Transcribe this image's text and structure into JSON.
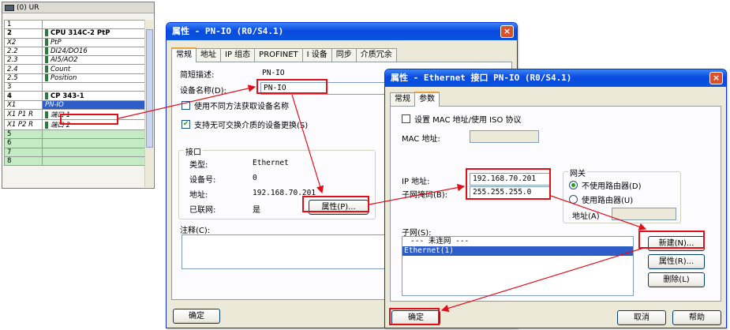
{
  "rack": {
    "title": "(0) UR",
    "rows": [
      {
        "slot": "1",
        "module": "",
        "style": "plain"
      },
      {
        "slot": "2",
        "module": "CPU 314C-2 PtP",
        "style": "bold",
        "icon": true
      },
      {
        "slot": "X2",
        "module": "PtP",
        "style": "italic",
        "icon": true
      },
      {
        "slot": "2.2",
        "module": "DI24/DO16",
        "style": "italic",
        "icon": true
      },
      {
        "slot": "2.3",
        "module": "AI5/AO2",
        "style": "italic",
        "icon": true
      },
      {
        "slot": "2.4",
        "module": "Count",
        "style": "italic",
        "icon": true
      },
      {
        "slot": "2.5",
        "module": "Position",
        "style": "italic",
        "icon": true
      },
      {
        "slot": "3",
        "module": "",
        "style": "plain"
      },
      {
        "slot": "4",
        "module": "CP 343-1",
        "style": "bold",
        "icon": true
      },
      {
        "slot": "X1",
        "module": "PN-IO",
        "style": "sel",
        "icon": false
      },
      {
        "slot": "X1 P1 R",
        "module": "端口 1",
        "style": "italic",
        "icon": true
      },
      {
        "slot": "X1 P2 R",
        "module": "端口 2",
        "style": "italic",
        "icon": true
      },
      {
        "slot": "5",
        "module": "",
        "style": "green"
      },
      {
        "slot": "6",
        "module": "",
        "style": "green"
      },
      {
        "slot": "7",
        "module": "",
        "style": "green"
      },
      {
        "slot": "8",
        "module": "",
        "style": "green"
      }
    ]
  },
  "dlg1": {
    "title": "属性 - PN-IO (R0/S4.1)",
    "close": "×",
    "tabs": [
      "常规",
      "地址",
      "IP 组态",
      "PROFINET",
      "I 设备",
      "同步",
      "介质冗余"
    ],
    "short_desc_label": "简短描述:",
    "short_desc_value": "PN-IO",
    "device_name_label": "设备名称(D):",
    "device_name_value": "PN-IO",
    "chk1_label": "使用不同方法获取设备名称",
    "chk2_label": "支持无可交换介质的设备更换(S)",
    "chk2_mark": "✔",
    "iface_group": "接口",
    "type_label": "类型:",
    "type_value": "Ethernet",
    "devno_label": "设备号:",
    "devno_value": "0",
    "addr_label": "地址:",
    "addr_value": "192.168.70.201",
    "networked_label": "已联网:",
    "networked_value": "是",
    "props_button": "属性(P)...",
    "comment_label": "注释(C):",
    "ok_button": "确定"
  },
  "dlg2": {
    "title": "属性 - Ethernet 接口 PN-IO (R0/S4.1)",
    "close": "×",
    "tabs": [
      "常规",
      "参数"
    ],
    "mac_chk_label": "设置 MAC 地址/使用 ISO 协议",
    "mac_label": "MAC 地址:",
    "ip_label": "IP 地址:",
    "ip_value": "192.168.70.201",
    "mask_label": "子网掩码(B):",
    "mask_value": "255.255.255.0",
    "gateway_group": "网关",
    "no_router": "不使用路由器(D)",
    "use_router": "使用路由器(U)",
    "gw_addr_label": "地址(A)",
    "subnet_label": "子网(S):",
    "subnets": [
      "--- 未连网 ---",
      "Ethernet(1)"
    ],
    "new_button": "新建(N)...",
    "props_button": "属性(R)...",
    "delete_button": "删除(L)",
    "ok_button": "确定",
    "cancel_button": "取消",
    "help_button": "帮助"
  },
  "colors": {
    "highlight": "#e0101a",
    "titlebar": "#0a4ae0",
    "selection": "#2f5dc8",
    "slot_green": "#c4ecc4"
  }
}
